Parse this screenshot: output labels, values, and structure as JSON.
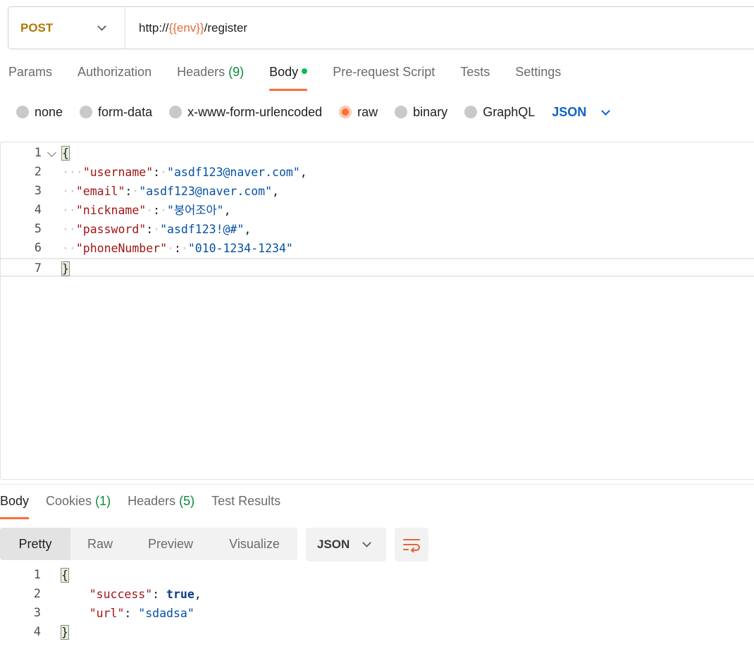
{
  "request": {
    "method": "POST",
    "url_prefix": "http://",
    "url_variable": "{{env}}",
    "url_suffix": "/register"
  },
  "request_tabs": [
    {
      "label": "Params"
    },
    {
      "label": "Authorization"
    },
    {
      "label": "Headers",
      "count": "(9)"
    },
    {
      "label": "Body",
      "active": true,
      "indicator": "green-dot"
    },
    {
      "label": "Pre-request Script"
    },
    {
      "label": "Tests"
    },
    {
      "label": "Settings"
    }
  ],
  "body_types": {
    "options": [
      "none",
      "form-data",
      "x-www-form-urlencoded",
      "raw",
      "binary",
      "GraphQL"
    ],
    "selected": "raw",
    "language": "JSON"
  },
  "request_body": {
    "line_numbers": [
      "1",
      "2",
      "3",
      "4",
      "5",
      "6",
      "7"
    ],
    "open_brace": "{",
    "close_brace": "}",
    "fields": [
      {
        "key": "\"username\"",
        "value": "\"asdf123@naver.com\"",
        "trail": ","
      },
      {
        "key": "\"email\"",
        "value": "\"asdf123@naver.com\"",
        "trail": ","
      },
      {
        "key": "\"nickname\"",
        "value": "\"붕어조아\"",
        "trail": ","
      },
      {
        "key": "\"password\"",
        "value": "\"asdf123!@#\"",
        "trail": ","
      },
      {
        "key": "\"phoneNumber\"",
        "value": "\"010-1234-1234\"",
        "trail": ""
      }
    ]
  },
  "response_tabs": [
    {
      "label": "Body",
      "active": true
    },
    {
      "label": "Cookies",
      "count": "(1)"
    },
    {
      "label": "Headers",
      "count": "(5)"
    },
    {
      "label": "Test Results"
    }
  ],
  "response_view": {
    "modes": [
      "Pretty",
      "Raw",
      "Preview",
      "Visualize"
    ],
    "active_mode": "Pretty",
    "format": "JSON",
    "wrap_icon": "wrap-lines-icon"
  },
  "response_body": {
    "line_numbers": [
      "1",
      "2",
      "3",
      "4"
    ],
    "open_brace": "{",
    "close_brace": "}",
    "fields": [
      {
        "key": "\"success\"",
        "value": "true",
        "trail": ","
      },
      {
        "key": "\"url\"",
        "value": "\"sdadsa\"",
        "trail": ""
      }
    ]
  },
  "colors": {
    "accent": "#ff6c37",
    "method": "#ad7a03",
    "url_variable": "#e66b3e",
    "json_key": "#a31515",
    "json_string": "#0451a5",
    "count_green": "#0a8a3a",
    "language_blue": "#0c64c7"
  }
}
